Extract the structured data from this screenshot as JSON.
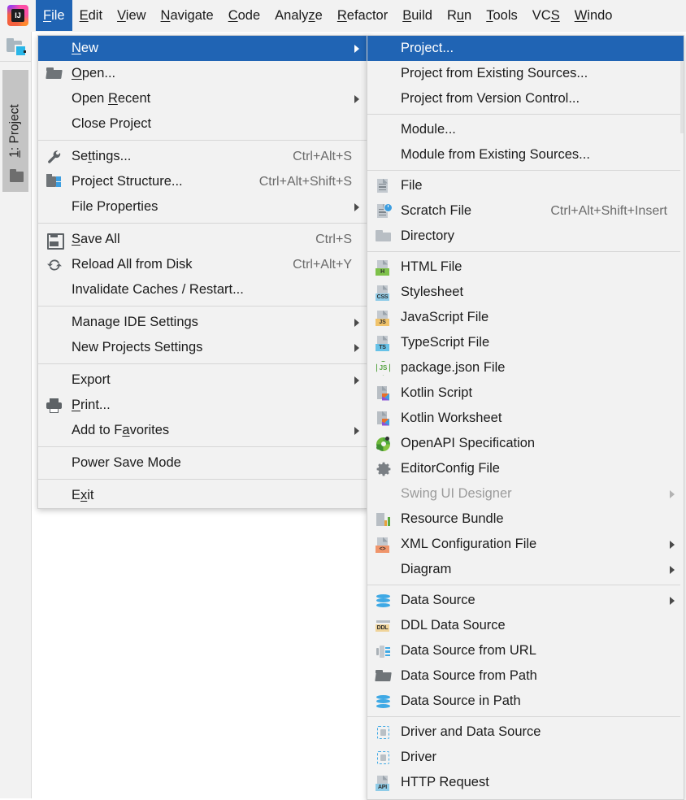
{
  "app": {
    "logo_text": "IJ",
    "logo_name": "intellij-idea-logo"
  },
  "menubar": {
    "items": [
      {
        "label": "File",
        "mnemonic": "F",
        "active": true
      },
      {
        "label": "Edit",
        "mnemonic": "E",
        "active": false
      },
      {
        "label": "View",
        "mnemonic": "V",
        "active": false
      },
      {
        "label": "Navigate",
        "mnemonic": "N",
        "active": false
      },
      {
        "label": "Code",
        "mnemonic": "C",
        "active": false
      },
      {
        "label": "Analyze",
        "mnemonic": "z",
        "active": false
      },
      {
        "label": "Refactor",
        "mnemonic": "R",
        "active": false
      },
      {
        "label": "Build",
        "mnemonic": "B",
        "active": false
      },
      {
        "label": "Run",
        "mnemonic": "u",
        "active": false
      },
      {
        "label": "Tools",
        "mnemonic": "T",
        "active": false
      },
      {
        "label": "VCS",
        "mnemonic": "S",
        "active": false
      },
      {
        "label": "Windo",
        "mnemonic": "W",
        "active": false
      }
    ]
  },
  "toolwindow": {
    "project_tab_label": "1: Project",
    "project_tab_mnemonic": "1",
    "project_icon": "project-folder-icon"
  },
  "file_menu": {
    "groups": [
      {
        "items": [
          {
            "label": "New",
            "mnemonic": "N",
            "icon": "none",
            "accel": "",
            "submenu": true,
            "selected": true
          },
          {
            "label": "Open...",
            "mnemonic": "O",
            "icon": "folder-open-icon",
            "accel": "",
            "submenu": false
          },
          {
            "label": "Open Recent",
            "mnemonic": "R",
            "icon": "none",
            "accel": "",
            "submenu": true
          },
          {
            "label": "Close Project",
            "mnemonic": "",
            "icon": "none",
            "accel": "",
            "submenu": false
          }
        ]
      },
      {
        "items": [
          {
            "label": "Settings...",
            "mnemonic": "t",
            "icon": "wrench-icon",
            "accel": "Ctrl+Alt+S",
            "submenu": false
          },
          {
            "label": "Project Structure...",
            "mnemonic": "",
            "icon": "project-structure-icon",
            "accel": "Ctrl+Alt+Shift+S",
            "submenu": false
          },
          {
            "label": "File Properties",
            "mnemonic": "",
            "icon": "none",
            "accel": "",
            "submenu": true
          }
        ]
      },
      {
        "items": [
          {
            "label": "Save All",
            "mnemonic": "S",
            "icon": "save-icon",
            "accel": "Ctrl+S",
            "submenu": false
          },
          {
            "label": "Reload All from Disk",
            "mnemonic": "",
            "icon": "reload-icon",
            "accel": "Ctrl+Alt+Y",
            "submenu": false
          },
          {
            "label": "Invalidate Caches / Restart...",
            "mnemonic": "",
            "icon": "none",
            "accel": "",
            "submenu": false
          }
        ]
      },
      {
        "items": [
          {
            "label": "Manage IDE Settings",
            "mnemonic": "",
            "icon": "none",
            "accel": "",
            "submenu": true
          },
          {
            "label": "New Projects Settings",
            "mnemonic": "",
            "icon": "none",
            "accel": "",
            "submenu": true
          }
        ]
      },
      {
        "items": [
          {
            "label": "Export",
            "mnemonic": "",
            "icon": "none",
            "accel": "",
            "submenu": true
          },
          {
            "label": "Print...",
            "mnemonic": "P",
            "icon": "printer-icon",
            "accel": "",
            "submenu": false
          },
          {
            "label": "Add to Favorites",
            "mnemonic": "a",
            "icon": "none",
            "accel": "",
            "submenu": true
          }
        ]
      },
      {
        "items": [
          {
            "label": "Power Save Mode",
            "mnemonic": "",
            "icon": "none",
            "accel": "",
            "submenu": false
          }
        ]
      },
      {
        "items": [
          {
            "label": "Exit",
            "mnemonic": "x",
            "icon": "none",
            "accel": "",
            "submenu": false
          }
        ]
      }
    ]
  },
  "new_submenu": {
    "groups": [
      {
        "items": [
          {
            "label": "Project...",
            "icon": "none",
            "accel": "",
            "submenu": false,
            "selected": true,
            "disabled": false
          },
          {
            "label": "Project from Existing Sources...",
            "icon": "none",
            "accel": "",
            "submenu": false,
            "disabled": false
          },
          {
            "label": "Project from Version Control...",
            "icon": "none",
            "accel": "",
            "submenu": false,
            "disabled": false
          }
        ]
      },
      {
        "items": [
          {
            "label": "Module...",
            "icon": "none",
            "accel": "",
            "submenu": false,
            "disabled": false
          },
          {
            "label": "Module from Existing Sources...",
            "icon": "none",
            "accel": "",
            "submenu": false,
            "disabled": false
          }
        ]
      },
      {
        "items": [
          {
            "label": "File",
            "icon": "file-icon",
            "accel": "",
            "submenu": false,
            "disabled": false
          },
          {
            "label": "Scratch File",
            "icon": "scratch-file-icon",
            "accel": "Ctrl+Alt+Shift+Insert",
            "submenu": false,
            "disabled": false
          },
          {
            "label": "Directory",
            "icon": "directory-icon",
            "accel": "",
            "submenu": false,
            "disabled": false
          }
        ]
      },
      {
        "items": [
          {
            "label": "HTML File",
            "icon": "html-file-icon",
            "tag": "H",
            "tag_color": "#7ec14a",
            "accel": "",
            "submenu": false,
            "disabled": false
          },
          {
            "label": "Stylesheet",
            "icon": "css-file-icon",
            "tag": "CSS",
            "tag_color": "#8fcce8",
            "accel": "",
            "submenu": false,
            "disabled": false
          },
          {
            "label": "JavaScript File",
            "icon": "javascript-file-icon",
            "tag": "JS",
            "tag_color": "#f0c36b",
            "accel": "",
            "submenu": false,
            "disabled": false
          },
          {
            "label": "TypeScript File",
            "icon": "typescript-file-icon",
            "tag": "TS",
            "tag_color": "#67c2e8",
            "accel": "",
            "submenu": false,
            "disabled": false
          },
          {
            "label": "package.json File",
            "icon": "nodejs-icon",
            "accel": "",
            "submenu": false,
            "disabled": false
          },
          {
            "label": "Kotlin Script",
            "icon": "kotlin-icon",
            "accel": "",
            "submenu": false,
            "disabled": false
          },
          {
            "label": "Kotlin Worksheet",
            "icon": "kotlin-icon",
            "accel": "",
            "submenu": false,
            "disabled": false
          },
          {
            "label": "OpenAPI Specification",
            "icon": "openapi-icon",
            "accel": "",
            "submenu": false,
            "disabled": false
          },
          {
            "label": "EditorConfig File",
            "icon": "gear-icon",
            "accel": "",
            "submenu": false,
            "disabled": false
          },
          {
            "label": "Swing UI Designer",
            "icon": "none",
            "accel": "",
            "submenu": true,
            "disabled": true
          },
          {
            "label": "Resource Bundle",
            "icon": "resource-bundle-icon",
            "accel": "",
            "submenu": false,
            "disabled": false
          },
          {
            "label": "XML Configuration File",
            "icon": "xml-file-icon",
            "tag": "<>",
            "tag_color": "#f0956b",
            "accel": "",
            "submenu": true,
            "disabled": false
          },
          {
            "label": "Diagram",
            "icon": "none",
            "accel": "",
            "submenu": true,
            "disabled": false
          }
        ]
      },
      {
        "items": [
          {
            "label": "Data Source",
            "icon": "database-icon",
            "accel": "",
            "submenu": true,
            "disabled": false
          },
          {
            "label": "DDL Data Source",
            "icon": "ddl-data-source-icon",
            "tag": "DDL",
            "tag_color": "#f0d49a",
            "accel": "",
            "submenu": false,
            "disabled": false
          },
          {
            "label": "Data Source from URL",
            "icon": "data-source-url-icon",
            "accel": "",
            "submenu": false,
            "disabled": false
          },
          {
            "label": "Data Source from Path",
            "icon": "folder-open-icon",
            "accel": "",
            "submenu": false,
            "disabled": false
          },
          {
            "label": "Data Source in Path",
            "icon": "database-icon",
            "accel": "",
            "submenu": false,
            "disabled": false
          }
        ]
      },
      {
        "items": [
          {
            "label": "Driver and Data Source",
            "icon": "driver-icon",
            "accel": "",
            "submenu": false,
            "disabled": false
          },
          {
            "label": "Driver",
            "icon": "driver-icon",
            "accel": "",
            "submenu": false,
            "disabled": false
          },
          {
            "label": "HTTP Request",
            "icon": "http-request-icon",
            "tag": "API",
            "tag_color": "#8fcce8",
            "accel": "",
            "submenu": false,
            "disabled": false
          }
        ]
      }
    ]
  },
  "colors": {
    "selection_blue": "#2064b4",
    "menu_background": "#f2f2f2",
    "text": "#1c1c1c",
    "disabled_text": "#9b9b9b",
    "accel_text": "#6b6b6b"
  }
}
